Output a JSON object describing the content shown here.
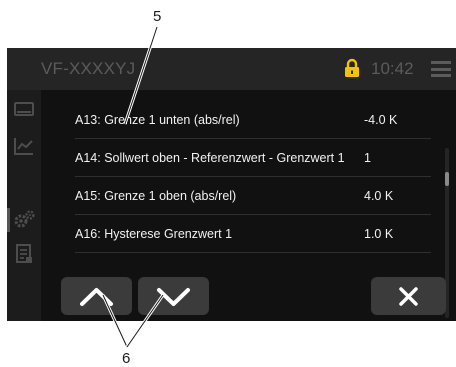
{
  "callouts": {
    "top": "5",
    "bottom": "6"
  },
  "status": {
    "device_id": "VF-XXXXYJ",
    "time": "10:42"
  },
  "parameters": [
    {
      "code": "A13:",
      "label": "Grenze 1 unten (abs/rel)",
      "value": "-4.0 K"
    },
    {
      "code": "A14:",
      "label": "Sollwert oben - Referenzwert - Grenzwert 1",
      "value": "1"
    },
    {
      "code": "A15:",
      "label": "Grenze 1 oben (abs/rel)",
      "value": "4.0 K"
    },
    {
      "code": "A16:",
      "label": "Hysterese Grenzwert 1",
      "value": "1.0 K"
    }
  ],
  "icons": {
    "lock": "lock-icon",
    "menu": "hamburger-menu-icon",
    "side": [
      "display-icon",
      "chart-icon",
      "settings-gears-icon",
      "document-icon"
    ],
    "up": "chevron-up-icon",
    "down": "chevron-down-icon",
    "close": "close-icon"
  },
  "colors": {
    "lock": "#f5c400",
    "background": "#111111",
    "statusbar": "#252525",
    "button": "#3b3b3b"
  }
}
